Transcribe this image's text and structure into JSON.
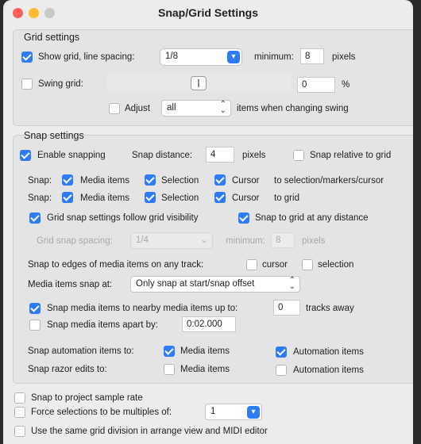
{
  "window": {
    "title": "Snap/Grid Settings"
  },
  "grid": {
    "heading": "Grid settings",
    "show_grid_label": "Show grid, line spacing:",
    "line_spacing_value": "1/8",
    "minimum_label": "minimum:",
    "minimum_value": "8",
    "pixels_label": "pixels",
    "swing_label": "Swing grid:",
    "swing_value": "0",
    "percent": "%",
    "adjust_label": "Adjust",
    "adjust_value": "all",
    "adjust_suffix": "items when changing swing"
  },
  "snap": {
    "heading": "Snap settings",
    "enable_label": "Enable snapping",
    "distance_label": "Snap distance:",
    "distance_value": "4",
    "distance_pixels": "pixels",
    "relative_label": "Snap relative to grid",
    "snap_word": "Snap:",
    "media_items": "Media items",
    "selection": "Selection",
    "cursor": "Cursor",
    "row1_suffix": "to selection/markers/cursor",
    "row2_suffix": "to grid",
    "follow_grid_label": "Grid snap settings follow grid visibility",
    "any_distance_label": "Snap to grid at any distance",
    "grid_spacing_label": "Grid snap spacing:",
    "grid_spacing_value": "1/4",
    "grid_min_label": "minimum:",
    "grid_min_value": "8",
    "grid_pixels": "pixels",
    "edges_label": "Snap to edges of media items on any track:",
    "edges_cursor": "cursor",
    "edges_selection": "selection",
    "media_snap_label": "Media items snap at:",
    "media_snap_value": "Only snap at start/snap offset",
    "nearby_label": "Snap media items to nearby media items up to:",
    "nearby_value": "0",
    "nearby_suffix": "tracks away",
    "apart_label": "Snap media items apart by:",
    "apart_value": "0:02.000",
    "automation_label": "Snap automation items to:",
    "auto_media": "Media items",
    "auto_automation": "Automation items",
    "razor_label": "Snap razor edits to:",
    "razor_media": "Media items",
    "razor_automation": "Automation items"
  },
  "bottom": {
    "sample_rate_label": "Snap to project sample rate",
    "force_label": "Force selections to be multiples of:",
    "force_value": "1",
    "same_grid_label": "Use the same grid division in arrange view and MIDI editor"
  },
  "colors": {
    "accent": "#2d7cf6",
    "window_bg": "#ececec",
    "group_bg": "#e4e4e4"
  }
}
